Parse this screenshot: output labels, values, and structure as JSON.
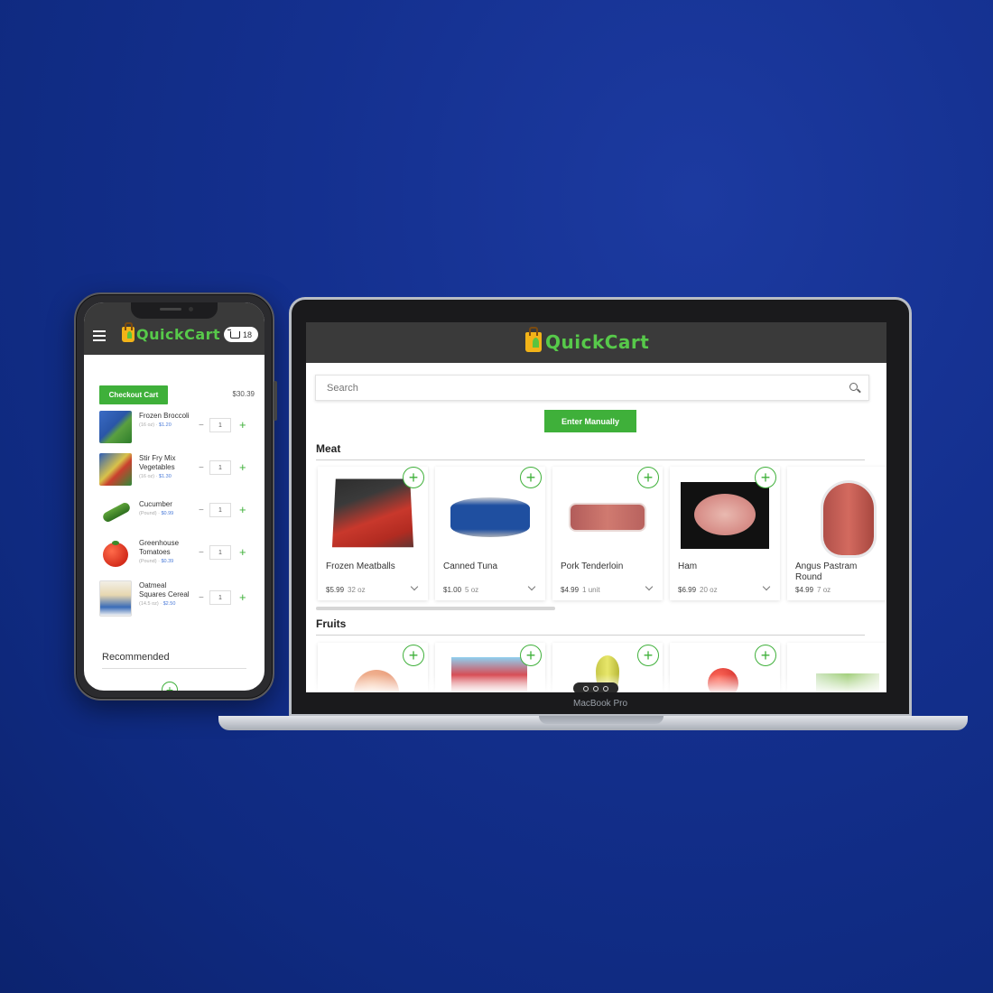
{
  "brand": {
    "name": "QuickCart",
    "accent": "#3fb03a",
    "header_bg": "#3a3a3a"
  },
  "phone": {
    "cart_count": "18",
    "checkout_label": "Checkout Cart",
    "cart_total": "$30.39",
    "items": [
      {
        "name": "Frozen Broccoli",
        "size": "(16 oz)",
        "price": "$1.20",
        "qty": "1",
        "thumb": "broccoli"
      },
      {
        "name": "Stir Fry Mix Vegetables",
        "size": "(16 oz)",
        "price": "$1.30",
        "qty": "1",
        "thumb": "stirfry"
      },
      {
        "name": "Cucumber",
        "size": "(Pound)",
        "price": "$0.99",
        "qty": "1",
        "thumb": "cucumber"
      },
      {
        "name": "Greenhouse Tomatoes",
        "size": "(Pound)",
        "price": "$0.39",
        "qty": "1",
        "thumb": "tomato"
      },
      {
        "name": "Oatmeal Squares Cereal",
        "size": "(14.5 oz)",
        "price": "$2.50",
        "qty": "1",
        "thumb": "cereal"
      }
    ],
    "recommended_label": "Recommended"
  },
  "web": {
    "search_placeholder": "Search",
    "enter_manually_label": "Enter Manually",
    "sections": {
      "meat": "Meat",
      "fruits": "Fruits"
    },
    "meat_products": [
      {
        "name": "Frozen Meatballs",
        "price": "$5.99",
        "unit": "32 oz",
        "img": "meatballs"
      },
      {
        "name": "Canned Tuna",
        "price": "$1.00",
        "unit": "5 oz",
        "img": "tuna"
      },
      {
        "name": "Pork Tenderloin",
        "price": "$4.99",
        "unit": "1 unit",
        "img": "pork"
      },
      {
        "name": "Ham",
        "price": "$6.99",
        "unit": "20 oz",
        "img": "ham"
      },
      {
        "name": "Angus Pastram Round",
        "price": "$4.99",
        "unit": "7 oz",
        "img": "pastrami"
      }
    ]
  },
  "laptop": {
    "model_label": "MacBook Pro"
  }
}
